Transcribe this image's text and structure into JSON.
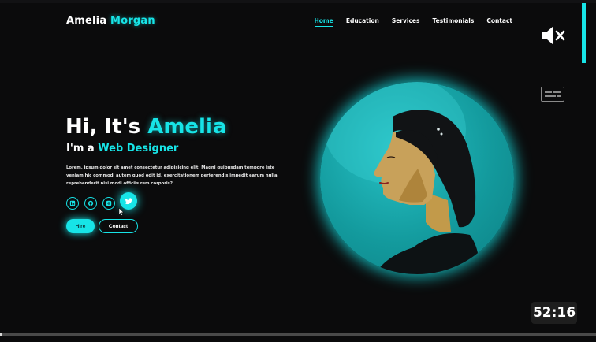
{
  "header": {
    "logo_first": "Amelia",
    "logo_last": "Morgan",
    "nav": [
      {
        "label": "Home",
        "active": true
      },
      {
        "label": "Education",
        "active": false
      },
      {
        "label": "Services",
        "active": false
      },
      {
        "label": "Testimonials",
        "active": false
      },
      {
        "label": "Contact",
        "active": false
      }
    ]
  },
  "hero": {
    "greeting": "Hi, It's",
    "name": "Amelia",
    "role_prefix": "I'm a",
    "role": "Web Designer",
    "description": "Lorem, ipsum dolor sit amet consectetur adipisicing elit. Magni quibusdam tempore iste veniam hic commodi autem quod odit id, exercitationem perferendis impedit earum nulla reprehenderit nisi modi officiis rem corporis?",
    "socials": [
      "linkedin-icon",
      "github-icon",
      "instagram-icon",
      "twitter-icon"
    ],
    "hire_label": "Hire",
    "contact_label": "Contact"
  },
  "player": {
    "timestamp": "52:16",
    "progress": 0.003,
    "icons": [
      "mute-icon",
      "captions-icon"
    ]
  },
  "colors": {
    "accent": "#17e4e7",
    "background": "#0b0b0c"
  }
}
